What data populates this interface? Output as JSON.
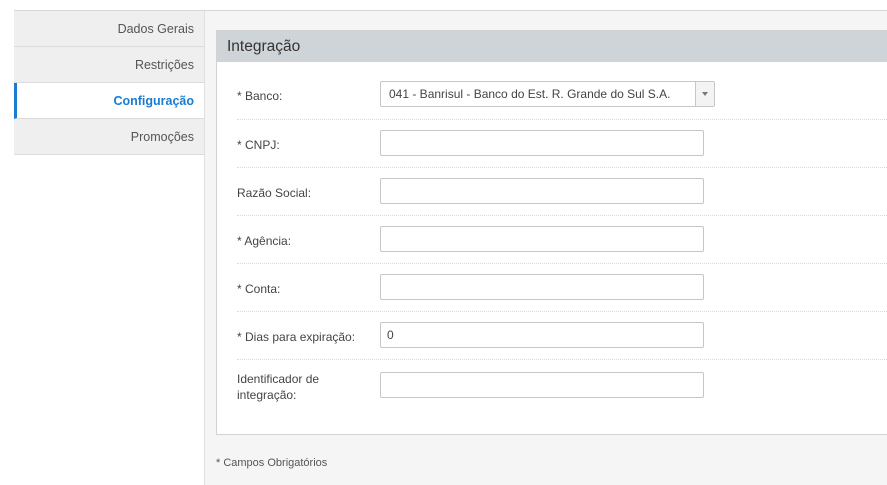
{
  "sidebar": {
    "items": [
      {
        "label": "Dados Gerais"
      },
      {
        "label": "Restrições"
      },
      {
        "label": "Configuração"
      },
      {
        "label": "Promoções"
      }
    ]
  },
  "panel": {
    "title": "Integração",
    "fields": {
      "banco": {
        "label": "* Banco:",
        "value": "041 - Banrisul - Banco do Est. R. Grande do Sul S.A."
      },
      "cnpj": {
        "label": "* CNPJ:",
        "value": ""
      },
      "razao_social": {
        "label": "Razão Social:",
        "value": ""
      },
      "agencia": {
        "label": "* Agência:",
        "value": ""
      },
      "conta": {
        "label": "* Conta:",
        "value": ""
      },
      "dias_expiracao": {
        "label": "* Dias para expiração:",
        "value": "0"
      },
      "identificador": {
        "label": "Identificador de integração:",
        "value": ""
      }
    }
  },
  "footnote": "* Campos Obrigatórios"
}
